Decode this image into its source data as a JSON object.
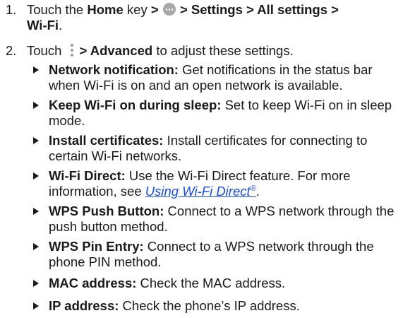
{
  "steps": [
    {
      "number": "1.",
      "pre": "Touch the ",
      "home": "Home",
      "mid": " key ",
      "sep1": ">",
      "path_rest": " > Settings > All settings >",
      "wifi": "Wi-Fi",
      "period": "."
    },
    {
      "number": "2.",
      "pre": "Touch ",
      "bold": "> Advanced",
      "post": " to adjust these settings."
    }
  ],
  "icons": {
    "apps": "apps-grid-icon",
    "menu": "vertical-dots-menu-icon",
    "bullet": "triangle-bullet-icon"
  },
  "settings": [
    {
      "label": "Network notification:",
      "text": " Get notifications in the status bar when Wi-Fi is on and an open network is available."
    },
    {
      "label": "Keep Wi-Fi on during sleep:",
      "text": " Set to keep Wi-Fi on in sleep mode."
    },
    {
      "label": "Install certificates:",
      "text": " Install certificates for connecting to certain Wi-Fi networks."
    },
    {
      "label": "Wi-Fi Direct:",
      "text": " Use the Wi-Fi Direct feature. For more information, see ",
      "link": "Using Wi-Fi Direct",
      "link_sup": "®",
      "after": "."
    },
    {
      "label": "WPS Push Button:",
      "text": " Connect to a WPS network through the push button method."
    },
    {
      "label": "WPS Pin Entry:",
      "text": " Connect to a WPS network through the phone PIN method."
    },
    {
      "label": "MAC address:",
      "text": " Check the MAC address."
    },
    {
      "label": "IP address:",
      "text": " Check the phone’s IP address."
    }
  ],
  "colors": {
    "text": "#1a1a1a",
    "link": "#1a4fd6",
    "icon": "#a8a8a8"
  }
}
